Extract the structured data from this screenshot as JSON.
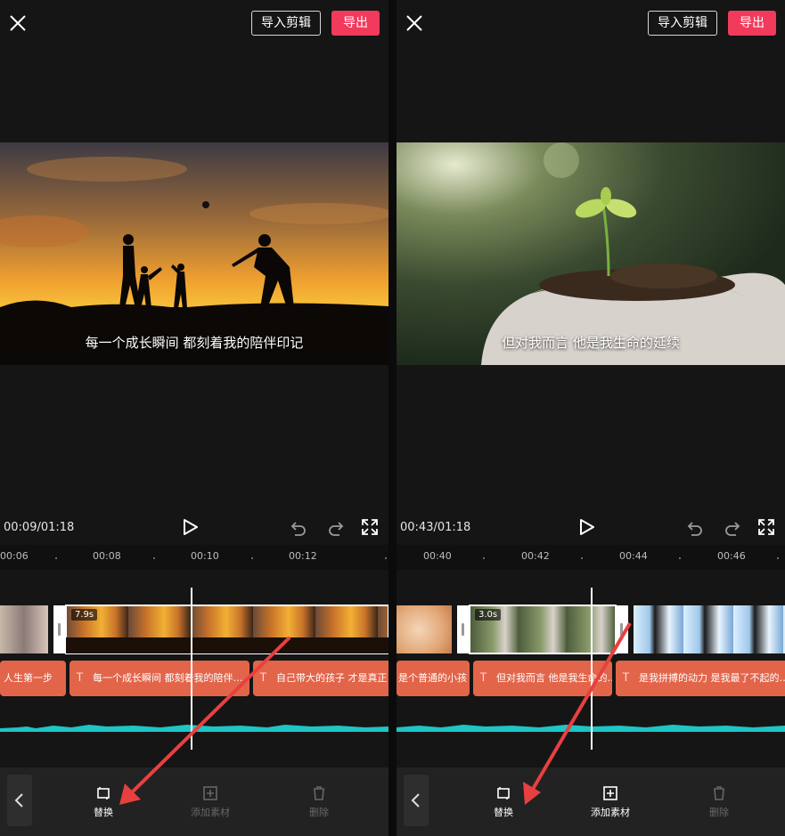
{
  "panels": [
    {
      "import_label": "导入剪辑",
      "export_label": "导出",
      "subtitle": "每一个成长瞬间 都刻着我的陪伴印记",
      "timecode": "00:09/01:18",
      "ticks": [
        "00:06",
        "00:08",
        "00:10",
        "00:12"
      ],
      "clip_duration": "7.9s",
      "subtitles": [
        "人生第一步",
        "每一个成长瞬间 都刻着我的陪伴…",
        "自己带大的孩子 才是真正"
      ],
      "tools": {
        "replace": "替换",
        "add": "添加素材",
        "delete": "删除"
      }
    },
    {
      "import_label": "导入剪辑",
      "export_label": "导出",
      "subtitle": "但对我而言 他是我生命的延续",
      "timecode": "00:43/01:18",
      "ticks": [
        "00:40",
        "00:42",
        "00:44",
        "00:46"
      ],
      "clip_duration": "3.0s",
      "subtitles": [
        "是个普通的小孩",
        "但对我而言 他是我生命的…",
        "是我拼搏的动力 是我最了不起的…"
      ],
      "tools": {
        "replace": "替换",
        "add": "添加素材",
        "delete": "删除"
      }
    }
  ],
  "colors": {
    "accent": "#f23a5c",
    "subtitle_track": "#e2654a",
    "waveform": "#1ec5c5",
    "arrow": "#e84040"
  },
  "icons": [
    "close-icon",
    "play-icon",
    "undo-icon",
    "redo-icon",
    "fullscreen-icon",
    "back-chevron-icon",
    "replace-icon",
    "add-media-icon",
    "delete-icon"
  ]
}
